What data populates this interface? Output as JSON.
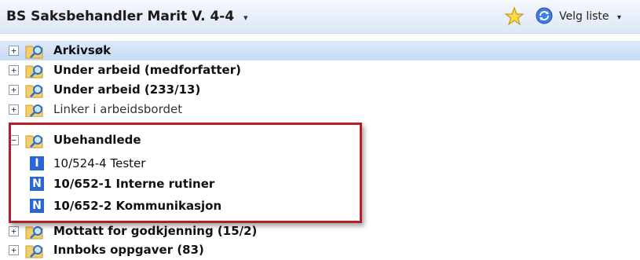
{
  "header": {
    "title": "BS Saksbehandler Marit V.  4-4",
    "title_caret": "▾",
    "velg_label": "Velg liste",
    "velg_caret": "▾"
  },
  "tree": {
    "items": [
      {
        "expander": "+",
        "label": "Arkivsøk",
        "selected": true
      },
      {
        "expander": "+",
        "label": "Under arbeid (medforfatter)"
      },
      {
        "expander": "+",
        "label": "Under arbeid (233/13)"
      },
      {
        "expander": "+",
        "label": "Linker i arbeidsbordet"
      },
      {
        "expander": "−",
        "label": "Ubehandlede",
        "children": [
          {
            "badge": "I",
            "label": "10/524-4 Tester",
            "bold": false
          },
          {
            "badge": "N",
            "label": "10/652-1 Interne rutiner",
            "bold": true
          },
          {
            "badge": "N",
            "label": "10/652-2 Kommunikasjon",
            "bold": true
          }
        ]
      },
      {
        "expander": "+",
        "label": "Mottatt for godkjenning (15/2)"
      },
      {
        "expander": "+",
        "label": "Innboks oppgaver (83)"
      }
    ]
  },
  "colors": {
    "header_bg": "#dde7f6",
    "selected_bg": "#c7dbf4",
    "badge_blue": "#2a66d6",
    "highlight_red": "#b51d28"
  }
}
